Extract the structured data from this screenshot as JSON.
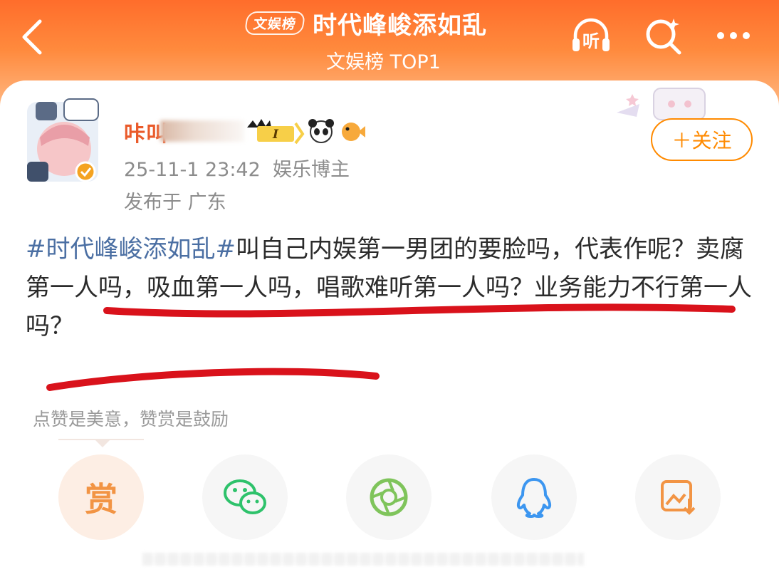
{
  "header": {
    "badge": "文娱榜",
    "title": "时代峰峻添如乱",
    "subtitle": "文娱榜 TOP1",
    "icons": [
      "back-arrow-icon",
      "listen-headphones-icon",
      "search-icon",
      "more-icon"
    ],
    "listen_label": "听"
  },
  "post": {
    "username": "咔叫",
    "time": "25-11-1 23:42",
    "role": "娱乐博主",
    "location": "发布于 广东",
    "follow_label": "＋关注",
    "badge_level": "I",
    "hashtag": "#时代峰峻添如乱#",
    "body": "叫自己内娱第一男团的要脸吗，代表作呢？卖腐第一人吗，吸血第一人吗，唱歌难听第一人吗？业务能力不行第一人吗？",
    "reward_hint": "点赞是美意，赞赏是鼓励"
  },
  "share_bar": {
    "items": [
      {
        "name": "reward",
        "label": "赏"
      },
      {
        "name": "wechat",
        "icon": "wechat-icon"
      },
      {
        "name": "moments",
        "icon": "moments-icon"
      },
      {
        "name": "qq",
        "icon": "qq-icon"
      },
      {
        "name": "save-image",
        "icon": "save-image-icon"
      }
    ]
  },
  "colors": {
    "header_orange": "#ff6d2b",
    "username": "#ea5b2b",
    "hashtag": "#4b6fa3",
    "follow": "#ff8a00",
    "annotation_red": "#d9121b"
  }
}
